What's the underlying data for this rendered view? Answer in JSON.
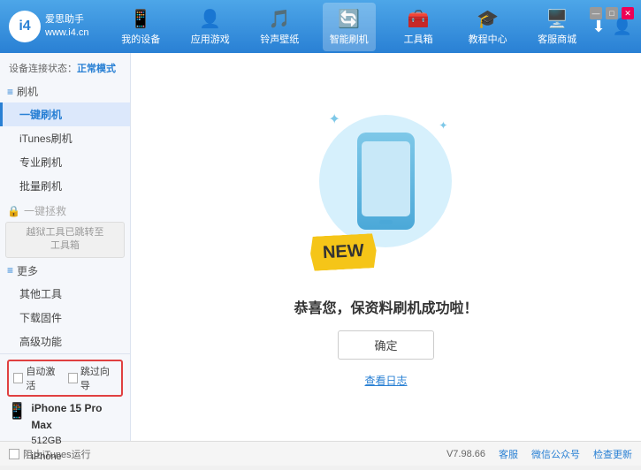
{
  "header": {
    "logo_text_line1": "爱思助手",
    "logo_text_line2": "www.i4.cn",
    "logo_char": "i4",
    "nav_items": [
      {
        "id": "my-device",
        "label": "我的设备",
        "icon": "📱"
      },
      {
        "id": "apps-games",
        "label": "应用游戏",
        "icon": "👤"
      },
      {
        "id": "ringtones",
        "label": "铃声壁纸",
        "icon": "🎵"
      },
      {
        "id": "smart-flash",
        "label": "智能刷机",
        "icon": "🔄",
        "active": true
      },
      {
        "id": "toolbox",
        "label": "工具箱",
        "icon": "🧰"
      },
      {
        "id": "tutorial",
        "label": "教程中心",
        "icon": "🎓"
      },
      {
        "id": "service",
        "label": "客服商城",
        "icon": "🖥️"
      }
    ]
  },
  "window_controls": {
    "minimize": "—",
    "maximize": "□",
    "close": "✕"
  },
  "sidebar": {
    "status_label": "设备连接状态：",
    "status_value": "正常模式",
    "sections": [
      {
        "id": "flash-group",
        "header": "刷机",
        "items": [
          {
            "id": "one-key-flash",
            "label": "一键刷机",
            "active": true
          },
          {
            "id": "itunes-flash",
            "label": "iTunes刷机"
          },
          {
            "id": "pro-flash",
            "label": "专业刷机"
          },
          {
            "id": "batch-flash",
            "label": "批量刷机"
          }
        ]
      },
      {
        "id": "one-key-rescue-group",
        "header": "一键拯救",
        "disabled": true,
        "disabled_text_line1": "越狱工具已跳转至",
        "disabled_text_line2": "工具箱"
      },
      {
        "id": "more-group",
        "header": "更多",
        "items": [
          {
            "id": "other-tools",
            "label": "其他工具"
          },
          {
            "id": "download-firmware",
            "label": "下载固件"
          },
          {
            "id": "advanced",
            "label": "高级功能"
          }
        ]
      }
    ],
    "bottom": {
      "auto_activate_label": "自动激活",
      "guide_label": "跳过向导",
      "device_name": "iPhone 15 Pro Max",
      "device_storage": "512GB",
      "device_type": "iPhone"
    }
  },
  "content": {
    "success_text": "恭喜您，保资料刷机成功啦！",
    "confirm_button": "确定",
    "view_log": "查看日志",
    "new_badge": "NEW",
    "sparkle1": "✦",
    "sparkle2": "✦"
  },
  "footer": {
    "stop_itunes_label": "阻止iTunes运行",
    "version": "V7.98.66",
    "links": [
      {
        "id": "home",
        "label": "客服"
      },
      {
        "id": "wechat",
        "label": "微信公众号"
      },
      {
        "id": "check-update",
        "label": "检查更新"
      }
    ]
  }
}
